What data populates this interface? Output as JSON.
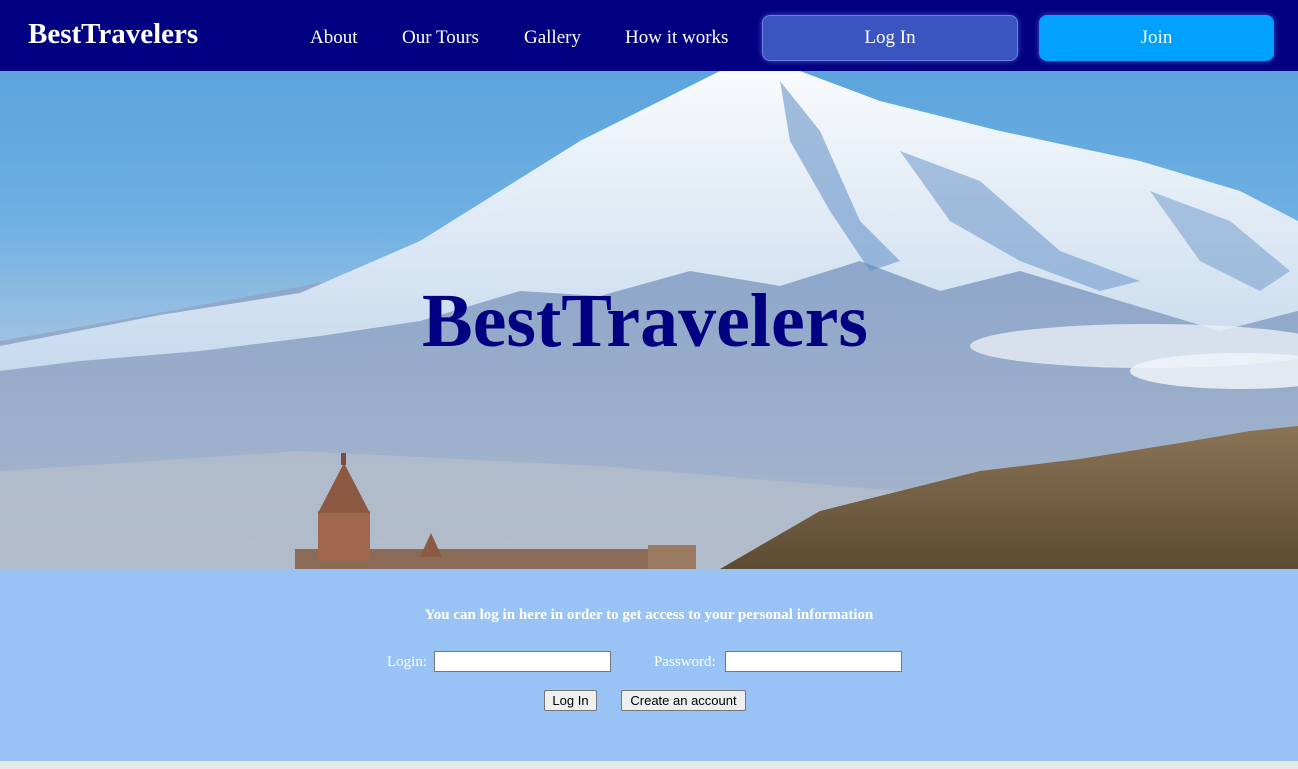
{
  "navbar": {
    "brand": "BestTravelers",
    "links": [
      "About",
      "Our Tours",
      "Gallery",
      "How it works"
    ],
    "login_label": "Log In",
    "join_label": "Join",
    "colors": {
      "background": "#000080",
      "login_button": "#3a55c0",
      "join_button": "#00a0ff"
    }
  },
  "hero": {
    "title": "BestTravelers",
    "title_color": "#000080"
  },
  "login_panel": {
    "message": "You can log in here in order to get access to your personal information",
    "login_label": "Login:",
    "login_value": "",
    "password_label": "Password:",
    "password_value": "",
    "login_button": "Log In",
    "create_button": "Create an account",
    "background": "#99c2f5"
  }
}
